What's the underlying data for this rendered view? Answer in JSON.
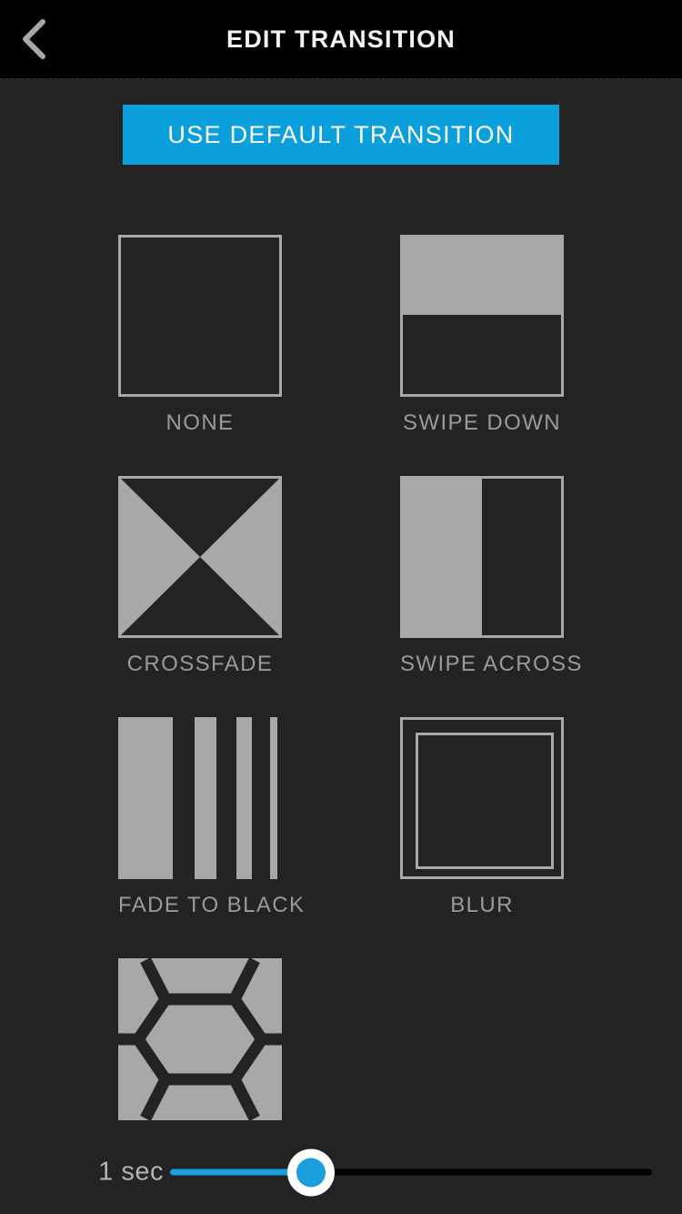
{
  "header": {
    "title": "EDIT TRANSITION",
    "back_icon": "chevron-left-icon",
    "background": "#000000",
    "title_color": "#f2f2f2"
  },
  "default_button": {
    "label": "USE DEFAULT TRANSITION",
    "background": "#0b9fdb",
    "text_color": "#ffffff"
  },
  "transitions": {
    "accent_gray": "#a8a8a8",
    "surface": "#232323",
    "items": [
      {
        "label": "NONE",
        "icon": "transition-none-icon",
        "selected": false
      },
      {
        "label": "SWIPE DOWN",
        "icon": "transition-swipe-down-icon",
        "selected": false
      },
      {
        "label": "CROSSFADE",
        "icon": "transition-crossfade-icon",
        "selected": false
      },
      {
        "label": "SWIPE ACROSS",
        "icon": "transition-swipe-across-icon",
        "selected": false
      },
      {
        "label": "FADE TO BLACK",
        "icon": "transition-fade-to-black-icon",
        "selected": false
      },
      {
        "label": "BLUR",
        "icon": "transition-blur-icon",
        "selected": false
      },
      {
        "label": "",
        "icon": "transition-honeycomb-icon",
        "selected": false
      }
    ]
  },
  "duration_slider": {
    "value_label": "1 sec",
    "value": 1,
    "min": 0,
    "max": 4,
    "percent": 29,
    "fill_color": "#1b9fdc",
    "track_color": "#000000",
    "thumb_color": "#ffffff"
  }
}
